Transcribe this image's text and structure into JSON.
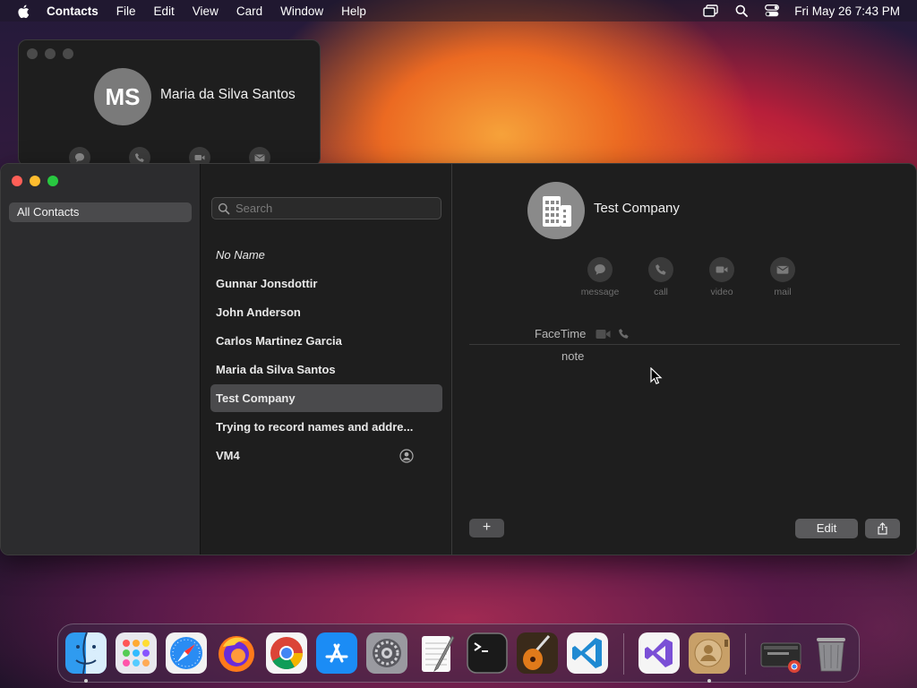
{
  "menubar": {
    "app_name": "Contacts",
    "items": [
      "File",
      "Edit",
      "View",
      "Card",
      "Window",
      "Help"
    ],
    "clock": "Fri May 26  7:43 PM"
  },
  "mini_window": {
    "initials": "MS",
    "name": "Maria da Silva Santos"
  },
  "sidebar": {
    "groups": [
      {
        "label": "All Contacts",
        "selected": true
      }
    ]
  },
  "contact_list": {
    "search_placeholder": "Search",
    "contacts": [
      {
        "name": "No Name",
        "italic": true
      },
      {
        "name": "Gunnar Jonsdottir"
      },
      {
        "name": "John Anderson"
      },
      {
        "name": "Carlos Martinez Garcia"
      },
      {
        "name": "Maria da Silva Santos"
      },
      {
        "name": "Test Company",
        "selected": true
      },
      {
        "name": "Trying to record names and addre..."
      },
      {
        "name": "VM4",
        "me_card": true
      }
    ]
  },
  "detail": {
    "name": "Test Company",
    "avatar_icon": "building-icon",
    "actions": [
      {
        "label": "message",
        "icon": "message-icon"
      },
      {
        "label": "call",
        "icon": "phone-icon"
      },
      {
        "label": "video",
        "icon": "video-icon"
      },
      {
        "label": "mail",
        "icon": "mail-icon"
      }
    ],
    "facetime_label": "FaceTime",
    "note_label": "note"
  },
  "buttons": {
    "add": "+",
    "edit": "Edit"
  },
  "dock": {
    "apps": [
      "Finder",
      "Launchpad",
      "Safari",
      "Firefox",
      "Chrome",
      "App Store",
      "System Settings",
      "TextEdit",
      "Terminal",
      "GarageBand",
      "Visual Studio Code",
      "Visual Studio",
      "Contacts",
      "Chrome Window",
      "Trash"
    ]
  }
}
